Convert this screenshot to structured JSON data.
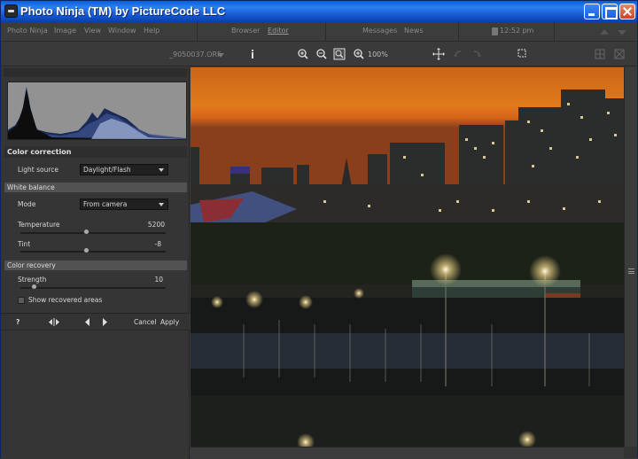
{
  "window": {
    "title": "Photo Ninja (TM) by PictureCode LLC"
  },
  "menu": {
    "items": [
      "Photo Ninja",
      "Image",
      "View",
      "Window",
      "Help"
    ],
    "browser": "Browser",
    "editor": "Editor",
    "messages": "Messages",
    "news": "News",
    "time": "12:52 pm"
  },
  "toolbar": {
    "filename": "_9050037.ORF",
    "zoom": "100%"
  },
  "panel": {
    "section_title": "Color correction",
    "light_source_label": "Light source",
    "light_source_value": "Daylight/Flash",
    "white_balance_title": "White balance",
    "mode_label": "Mode",
    "mode_value": "From camera",
    "temperature_label": "Temperature",
    "temperature_value": "5200",
    "temperature_level": 0.46,
    "tint_label": "Tint",
    "tint_value": "-8",
    "tint_level": 0.46,
    "color_recovery_title": "Color recovery",
    "strength_label": "Strength",
    "strength_value": "10",
    "strength_level": 0.1,
    "show_recovered_label": "Show recovered areas",
    "help": "?",
    "cancel": "Cancel",
    "apply": "Apply"
  },
  "colors": {
    "accent": "#0a5fd8",
    "panel": "#353535",
    "sky": "#e27a1c"
  }
}
